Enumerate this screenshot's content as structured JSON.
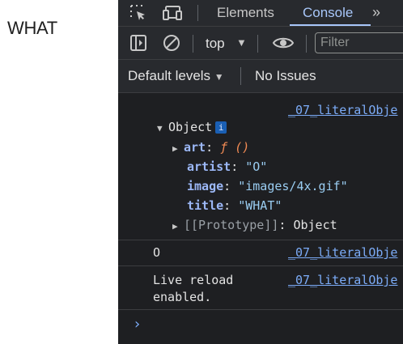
{
  "page": {
    "text": "WHAT"
  },
  "devtools": {
    "tabs": [
      {
        "label": "Elements"
      },
      {
        "label": "Console"
      }
    ],
    "more_tabs_icon": "chevron-double-right-icon",
    "context": {
      "label": "top"
    },
    "filter_placeholder": "Filter",
    "levels": {
      "label": "Default levels"
    },
    "issues": {
      "label": "No Issues"
    }
  },
  "console": {
    "source_link": "_07_literalObje",
    "object": {
      "label": "Object",
      "info_badge": "i",
      "props": [
        {
          "key": "art",
          "sep": ": ",
          "value": "ƒ ()"
        },
        {
          "key": "artist",
          "sep": ": ",
          "value": "\"O\""
        },
        {
          "key": "image",
          "sep": ": ",
          "value": "\"images/4x.gif\""
        },
        {
          "key": "title",
          "sep": ": ",
          "value": "\"WHAT\""
        }
      ],
      "prototype": {
        "key": "[[Prototype]]",
        "sep": ": ",
        "value": "Object"
      }
    },
    "msg2": {
      "text": "O"
    },
    "msg3": {
      "line1": "Live reload",
      "line2": "enabled."
    },
    "prompt": "›"
  }
}
